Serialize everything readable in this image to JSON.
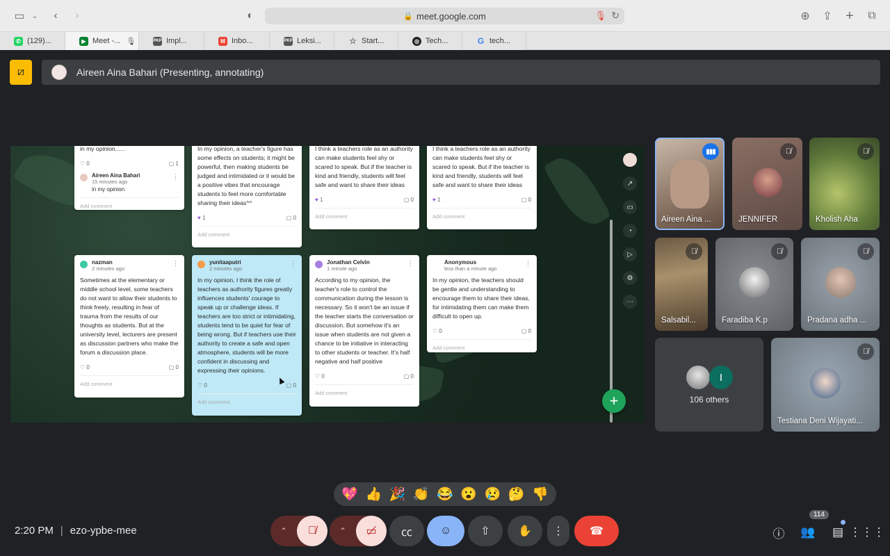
{
  "browser": {
    "url": "meet.google.com",
    "tabs": [
      {
        "label": "(129)...",
        "color": "#25d366",
        "glyph": "✆"
      },
      {
        "label": "Meet -...",
        "color": "#00832d",
        "glyph": "▶",
        "active": true
      },
      {
        "label": "Impl...",
        "color": "#555555",
        "glyph": "PKP"
      },
      {
        "label": "Inbo...",
        "color": "#ea4335",
        "glyph": "M"
      },
      {
        "label": "Leksi...",
        "color": "#555555",
        "glyph": "PKP"
      },
      {
        "label": "Start...",
        "color": "#777777",
        "glyph": "☆"
      },
      {
        "label": "Tech...",
        "color": "#222222",
        "glyph": "◎"
      },
      {
        "label": "tech...",
        "color": "#4285f4",
        "glyph": "G"
      }
    ]
  },
  "presenting": {
    "label": "Aireen Aina Bahari (Presenting, annotating)"
  },
  "padlet": {
    "cards": [
      {
        "id": "c1",
        "body": "in my opinion......",
        "likes": "0",
        "comments": "1",
        "liked": false,
        "reply_name": "Aireen Aina Bahari",
        "reply_time": "15 minutes ago",
        "reply_text": "in my opinion",
        "add_comment": "Add comment"
      },
      {
        "id": "c2",
        "body": "In my opinion, a teacher's figure has some effects on students; it might be powerful, then making students be judged and intimidated or it would be a positive vibes that encourage students to feel more comfortable sharing their ideas^^",
        "likes": "1",
        "comments": "0",
        "liked": true,
        "add_comment": "Add comment"
      },
      {
        "id": "c3",
        "body": "I think a teachers role as an authority can make students feel shy or scared to speak. But if the teacher is kind and friendly, students will feel safe and want to share their ideas",
        "likes": "1",
        "comments": "0",
        "liked": true,
        "add_comment": "Add comment"
      },
      {
        "id": "c4",
        "body": "I think a teachers role as an authority can make students feel shy or scared to speak. But if the teacher is kind and friendly, students will feel safe and want to share their ideas",
        "likes": "1",
        "comments": "0",
        "liked": true,
        "add_comment": "Add comment"
      },
      {
        "id": "c5",
        "author": "nazman",
        "time": "2 minutes ago",
        "body": "Sometimes at the elementary or middle school level, some teachers do not want to allow their students to think freely, resulting in fear of trauma from the results of our thoughts as students. But at the university level, lecturers are present as discussion partners who make the forum a discussion place.",
        "likes": "0",
        "comments": "0",
        "liked": false,
        "add_comment": "Add comment"
      },
      {
        "id": "c6",
        "author": "yunitaaputri",
        "time": "2 minutes ago",
        "body": "In my opinion, I think the role of teachers as authority figures greatly influences students' courage to speak up or challenge ideas. If teachers are too strict or intimidating, students tend to be quiet for fear of being wrong. But if teachers use their authority to create a safe and open atmosphere, students will be more confident in discussing and expressing their opinions.",
        "likes": "0",
        "comments": "0",
        "liked": false,
        "add_comment": "Add comment"
      },
      {
        "id": "c7",
        "author": "Jonathan Celvin",
        "time": "1 minute ago",
        "body": "According to my opinion, the teacher's role to control the communication during the lesson is necessary. So it won't be an issue if the teacher starts the conversation or discussion. But somehow it's an issue when students are not given a chance to be initiative in interacting to other students or teacher. It's half negative and half positive",
        "likes": "0",
        "comments": "0",
        "liked": false,
        "add_comment": "Add comment"
      },
      {
        "id": "c8",
        "author": "Anonymous",
        "time": "less than a minute ago",
        "body": "In my opinion, the teachers should be gentle and understanding to encourage them to share their ideas, for intimidating them can make them difficult to open up.",
        "likes": "0",
        "comments": "0",
        "liked": false,
        "add_comment": "Add comment"
      }
    ]
  },
  "participants": [
    {
      "name": "Aireen Aina ...",
      "speaking": true
    },
    {
      "name": "JENNIFER",
      "muted": true
    },
    {
      "name": "Kholish Aha",
      "muted": true
    },
    {
      "name": "Salsabil...",
      "muted": true
    },
    {
      "name": "Faradiba K.p",
      "muted": true
    },
    {
      "name": "Pradana adha ...",
      "muted": true
    },
    {
      "name": "106 others",
      "initial": "I"
    },
    {
      "name": "Testiana Deni Wijayati...",
      "muted": true
    }
  ],
  "reactions": [
    "💖",
    "👍",
    "🎉",
    "👏",
    "😂",
    "😮",
    "😢",
    "🤔",
    "👎"
  ],
  "bottom": {
    "time": "2:20 PM",
    "separator": "|",
    "meeting_code": "ezo-ypbe-mee",
    "participant_count": "114"
  },
  "colors": {
    "meet_bg": "#202124",
    "tile_bg": "#3c4043",
    "end_call": "#ea4335",
    "reactions_active": "#8ab4f8",
    "presenting_badge": "#fbbc04"
  }
}
